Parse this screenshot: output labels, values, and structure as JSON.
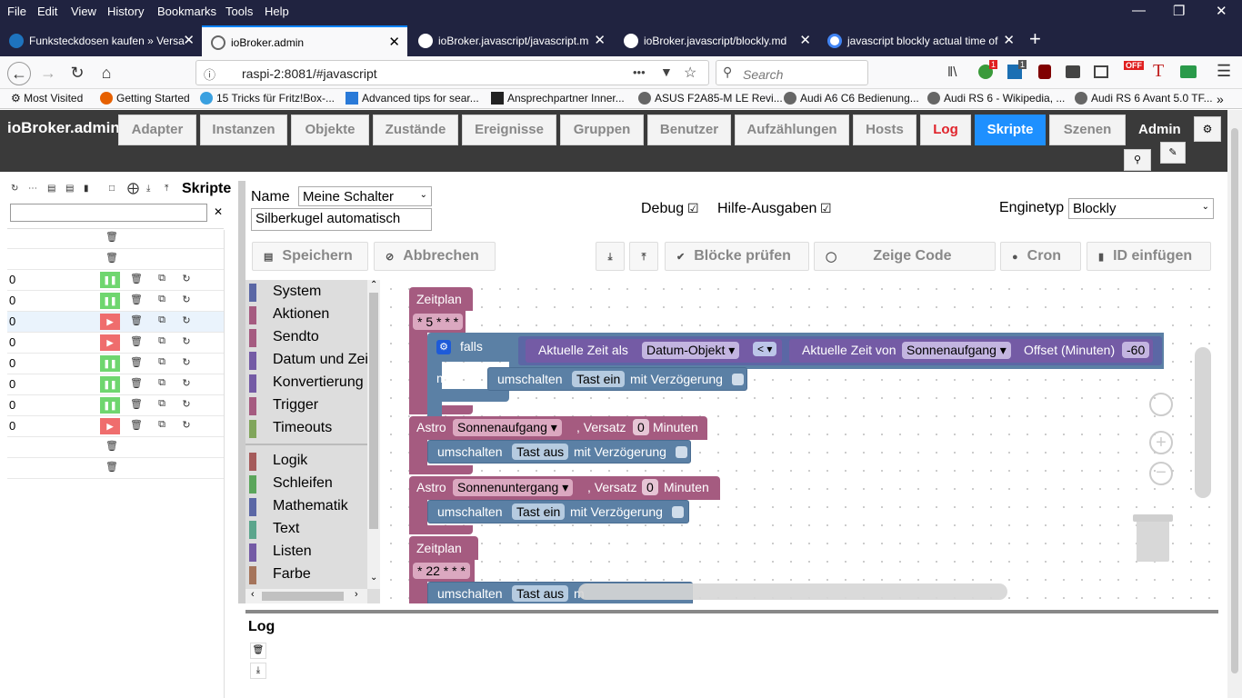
{
  "browser": {
    "menu": [
      "File",
      "Edit",
      "View",
      "History",
      "Bookmarks",
      "Tools",
      "Help"
    ],
    "tabs": [
      {
        "title": "Funksteckdosen kaufen » Versa",
        "active": false
      },
      {
        "title": "ioBroker.admin",
        "active": true
      },
      {
        "title": "ioBroker.javascript/javascript.m",
        "active": false
      },
      {
        "title": "ioBroker.javascript/blockly.md",
        "active": false
      },
      {
        "title": "javascript blockly actual time of",
        "active": false
      }
    ],
    "new_tab": "+",
    "url": "raspi-2:8081/#javascript",
    "url_more": "•••",
    "search_placeholder": "Search",
    "bookmarks": [
      "Most Visited",
      "Getting Started",
      "15 Tricks für Fritz!Box-...",
      "Advanced tips for sear...",
      "Ansprechpartner Inner...",
      "ASUS F2A85-M LE Revi...",
      "Audi A6 C6 Bedienung...",
      "Audi RS 6 - Wikipedia, ...",
      "Audi RS 6 Avant 5.0 TF..."
    ],
    "badges": {
      "b1": "1",
      "b2": "1",
      "off": "OFF",
      "t": "T"
    }
  },
  "app": {
    "brand": "ioBroker.admin",
    "nav": [
      "Adapter",
      "Instanzen",
      "Objekte",
      "Zustände",
      "Ereignisse",
      "Gruppen",
      "Benutzer",
      "Aufzählungen",
      "Hosts",
      "Log",
      "Skripte",
      "Szenen"
    ],
    "user": "Admin"
  },
  "scripts_panel": {
    "title": "Skripte",
    "rows": [
      {
        "num": "",
        "state": "trash"
      },
      {
        "num": "",
        "state": "trash"
      },
      {
        "num": "0",
        "state": "running"
      },
      {
        "num": "0",
        "state": "running"
      },
      {
        "num": "0",
        "state": "stopped"
      },
      {
        "num": "0",
        "state": "stopped"
      },
      {
        "num": "0",
        "state": "running"
      },
      {
        "num": "0",
        "state": "running"
      },
      {
        "num": "0",
        "state": "running"
      },
      {
        "num": "0",
        "state": "stopped"
      },
      {
        "num": "",
        "state": "trash"
      },
      {
        "num": "",
        "state": "trash"
      }
    ]
  },
  "editor": {
    "name_label": "Name",
    "folder_value": "Meine Schalter",
    "script_name": "Silberkugel automatisch",
    "debug_label": "Debug",
    "help_label": "Hilfe-Ausgaben",
    "engine_label": "Enginetyp",
    "engine_value": "Blockly",
    "buttons": {
      "save": "Speichern",
      "cancel": "Abbrechen",
      "check": "Blöcke prüfen",
      "show_code": "Zeige Code",
      "cron": "Cron",
      "insert_id": "ID einfügen"
    }
  },
  "toolbox": {
    "categories": [
      {
        "label": "System",
        "color": "#5b67a5"
      },
      {
        "label": "Aktionen",
        "color": "#a55b80"
      },
      {
        "label": "Sendto",
        "color": "#a55b80"
      },
      {
        "label": "Datum und Zeit",
        "color": "#745ba5"
      },
      {
        "label": "Konvertierung",
        "color": "#745ba5"
      },
      {
        "label": "Trigger",
        "color": "#a55b80"
      },
      {
        "label": "Timeouts",
        "color": "#80a55b"
      },
      {
        "label": "Logik",
        "color": "#a55b5b"
      },
      {
        "label": "Schleifen",
        "color": "#5ba55b"
      },
      {
        "label": "Mathematik",
        "color": "#5b67a5"
      },
      {
        "label": "Text",
        "color": "#5ba58c"
      },
      {
        "label": "Listen",
        "color": "#745ba5"
      },
      {
        "label": "Farbe",
        "color": "#a5745b"
      }
    ]
  },
  "blocks": {
    "zeitplan": "Zeitplan",
    "cron1": "* 5 * * *",
    "falls": "falls",
    "aktuelle_zeit_als": "Aktuelle Zeit als",
    "datum_objekt": "Datum-Objekt",
    "lt": "<",
    "aktuelle_zeit_von": "Aktuelle Zeit von",
    "sonnenaufgang": "Sonnenaufgang",
    "offset_label": "Offset (Minuten)",
    "offset_value": "-60",
    "mache": "mache",
    "umschalten": "umschalten",
    "tast_ein": "Tast ein",
    "tast_aus": "Tast aus",
    "mit_verzoegerung": "mit Verzögerung",
    "astro": "Astro",
    "versatz": ", Versatz",
    "zero": "0",
    "minuten": "Minuten",
    "sonnenuntergang": "Sonnenuntergang",
    "cron2": "* 22 * * *",
    "m_trunc": "m"
  },
  "log": {
    "title": "Log"
  },
  "colors": {
    "trigger": "#a55b80",
    "action": "#5b80a5",
    "time": "#745ba5",
    "play": "#ef6d6d",
    "pause": "#6fd66f",
    "header": "#3a3a3a"
  }
}
